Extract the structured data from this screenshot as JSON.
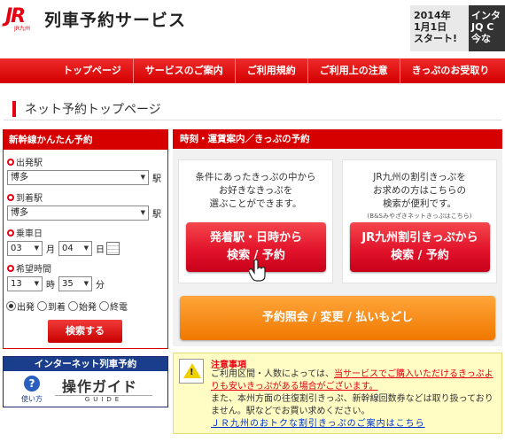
{
  "header": {
    "logo_mark": "JR",
    "logo_sub": "JR九州",
    "site_title": "列車予約サービス",
    "banner_left": [
      "2014年",
      "1月1日",
      "スタート!"
    ],
    "banner_right": [
      "インタ",
      "JQ C",
      "今な"
    ]
  },
  "nav": {
    "items": [
      "トップページ",
      "サービスのご案内",
      "ご利用規約",
      "ご利用上の注意",
      "きっぷのお受取り"
    ]
  },
  "page_title": "ネット予約トップページ",
  "quick_reserve": {
    "title": "新幹線かんたん予約",
    "departure_label": "出発駅",
    "departure_value": "博多",
    "arrival_label": "到着駅",
    "arrival_value": "博多",
    "station_suffix": "駅",
    "date_label": "乗車日",
    "month_value": "03",
    "month_unit": "月",
    "day_value": "04",
    "day_unit": "日",
    "time_label": "希望時間",
    "hour_value": "13",
    "hour_unit": "時",
    "minute_value": "35",
    "minute_unit": "分",
    "time_options": [
      "出発",
      "到着",
      "始発",
      "終電"
    ],
    "selected_option": "出発",
    "search_button": "検索する"
  },
  "guide": {
    "head": "インターネット列車予約",
    "help_caption": "使い方",
    "title": "操作ガイド",
    "subtitle": "GUIDE"
  },
  "info_panel": {
    "title": "時刻・運賃案内／きっぷの予約",
    "left_text": [
      "条件にあったきっぷの中から",
      "お好きなきっぷを",
      "選ぶことができます。"
    ],
    "left_button": [
      "発着駅・日時から",
      "検索 / 予約"
    ],
    "right_text": [
      "JR九州の割引きっぷを",
      "お求めの方はこちらの",
      "検索が便利です。"
    ],
    "right_note": "(B&Sみやざきネットきっぷはこちら)",
    "right_button": [
      "JR九州割引きっぷから",
      "検索 / 予約"
    ],
    "orange_button": "予約照会 / 変更 / 払いもどし"
  },
  "notice": {
    "title": "注意事項",
    "line1_plain": "ご利用区間・人数によっては、",
    "line1_highlight": "当サービスでご購入いただけるきっぷよりも安いきっぷがある場合がございます。",
    "line2": "また、本州方面の往復割引きっぷ、新幹線回数券などは取り扱っておりません。駅などでお買い求めください。",
    "link": "ＪＲ九州のおトクな割引きっぷのご案内はこちら"
  },
  "colors": {
    "brand_red": "#e60012",
    "nav_red": "#d40000",
    "orange": "#f07800",
    "guide_blue": "#1a3e8c",
    "notice_bg": "#fffcc4"
  }
}
